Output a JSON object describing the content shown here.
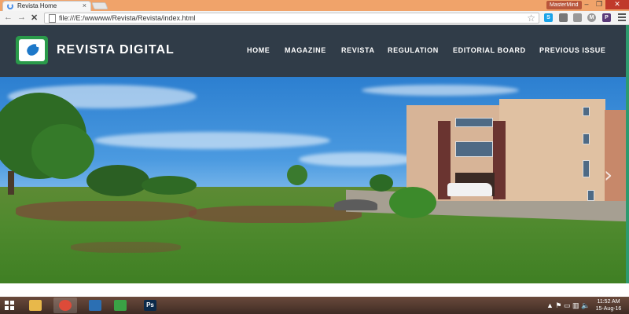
{
  "browser": {
    "tab_title": "Revista Home",
    "tab_close": "×",
    "user_badge": "MasterMind",
    "url": "file:///E:/wwwww/Revista/Revista/index.html",
    "window_controls": [
      "–",
      "❐",
      "✕"
    ],
    "extensions": [
      {
        "icon": "skype-icon",
        "label": "S",
        "color": "#1aa3e8"
      },
      {
        "icon": "tablet-icon",
        "label": "",
        "color": "#777777"
      },
      {
        "icon": "cloud-icon",
        "label": "",
        "color": "#999999"
      },
      {
        "icon": "m-icon",
        "label": "M",
        "color": "#9a9a9a"
      },
      {
        "icon": "p-icon",
        "label": "P",
        "color": "#5b3a7a"
      }
    ]
  },
  "site": {
    "brand": "REVISTA DIGITAL",
    "nav": [
      "HOME",
      "MAGAZINE",
      "REVISTA",
      "REGULATION",
      "EDITORIAL BOARD",
      "PREVIOUS ISSUE"
    ]
  },
  "hero": {
    "next_arrow": "›"
  },
  "taskbar": {
    "apps": [
      {
        "icon": "file-explorer-icon",
        "color": "#e8b84a",
        "label": ""
      },
      {
        "icon": "chrome-icon",
        "color": "#dd4b39",
        "label": ""
      },
      {
        "icon": "window-app-icon",
        "color": "#2b6fb3",
        "label": ""
      },
      {
        "icon": "camtasia-icon",
        "color": "#3aa345",
        "label": ""
      },
      {
        "icon": "photoshop-icon",
        "color": "#0b2a4a",
        "label": "Ps"
      }
    ],
    "time": "11:52 AM",
    "date": "15-Aug-16"
  }
}
